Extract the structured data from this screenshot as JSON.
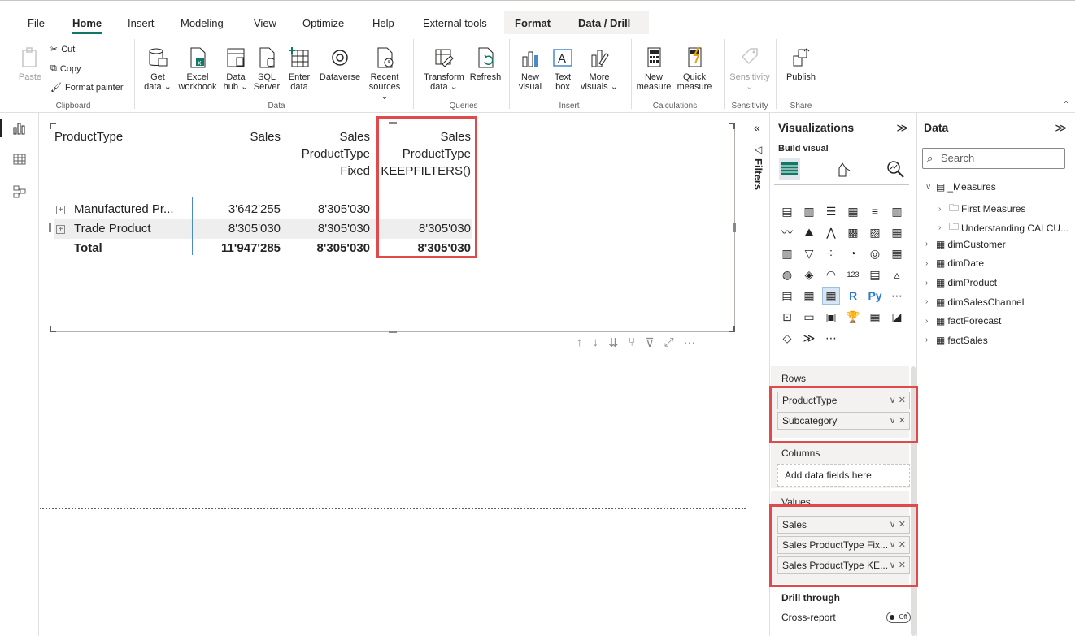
{
  "menu": {
    "tabs": [
      "File",
      "Home",
      "Insert",
      "Modeling",
      "View",
      "Optimize",
      "Help",
      "External tools"
    ],
    "active": "Home",
    "context_tabs": [
      "Format",
      "Data / Drill"
    ]
  },
  "ribbon": {
    "clipboard": {
      "paste": "Paste",
      "cut": "Cut",
      "copy": "Copy",
      "format_painter": "Format painter",
      "label": "Clipboard"
    },
    "data": {
      "get_data": [
        "Get",
        "data ⌄"
      ],
      "excel": [
        "Excel",
        "workbook"
      ],
      "data_hub": [
        "Data",
        "hub ⌄"
      ],
      "sql": [
        "SQL",
        "Server"
      ],
      "enter_data": [
        "Enter",
        "data"
      ],
      "dataverse": [
        "Dataverse",
        ""
      ],
      "recent": [
        "Recent",
        "sources ⌄"
      ],
      "label": "Data"
    },
    "queries": {
      "transform": [
        "Transform",
        "data ⌄"
      ],
      "refresh": [
        "Refresh",
        ""
      ],
      "label": "Queries"
    },
    "insert": {
      "new_visual": [
        "New",
        "visual"
      ],
      "text_box": [
        "Text",
        "box"
      ],
      "more_visuals": [
        "More",
        "visuals ⌄"
      ],
      "label": "Insert"
    },
    "calculations": {
      "new_measure": [
        "New",
        "measure"
      ],
      "quick_measure": [
        "Quick",
        "measure"
      ],
      "label": "Calculations"
    },
    "sensitivity": {
      "button": "Sensitivity",
      "caret": "⌄",
      "label": "Sensitivity"
    },
    "share": {
      "publish": "Publish",
      "label": "Share"
    }
  },
  "matrix": {
    "headers": {
      "row_header": "ProductType",
      "col1": [
        "Sales"
      ],
      "col2": [
        "Sales",
        "ProductType",
        "Fixed"
      ],
      "col3": [
        "Sales",
        "ProductType",
        "KEEPFILTERS()"
      ]
    },
    "rows": [
      {
        "label": "Manufactured Pr...",
        "sales": "3'642'255",
        "fixed": "8'305'030",
        "keep": ""
      },
      {
        "label": "Trade Product",
        "sales": "8'305'030",
        "fixed": "8'305'030",
        "keep": "8'305'030"
      }
    ],
    "total": {
      "label": "Total",
      "sales": "11'947'285",
      "fixed": "8'305'030",
      "keep": "8'305'030"
    },
    "expand_glyph": "+"
  },
  "visual_toolbar": [
    "↑",
    "↓",
    "⇊",
    "⑂",
    "⊽",
    "⤢",
    "⋯"
  ],
  "filters": {
    "label": "Filters",
    "collapse": "«",
    "funnel": "◁"
  },
  "visualizations": {
    "title": "Visualizations",
    "collapse": "≫",
    "build": "Build visual",
    "rows_label": "Rows",
    "rows": [
      "ProductType",
      "Subcategory"
    ],
    "columns_label": "Columns",
    "columns_placeholder": "Add data fields here",
    "values_label": "Values",
    "values": [
      "Sales",
      "Sales ProductType Fix...",
      "Sales ProductType KE..."
    ],
    "drill_label": "Drill through",
    "cross_report": "Cross-report",
    "toggle": "Off",
    "field_actions": "∨ ✕",
    "types": [
      "▤",
      "▥",
      "☰",
      "▦",
      "≡",
      "▥",
      "〰",
      "⛰",
      "⋀",
      "▩",
      "▨",
      "▦",
      "▥",
      "▽",
      "⁘",
      "◔",
      "◎",
      "▦",
      "◍",
      "◈",
      "◠",
      "123",
      "▤",
      "▵",
      "▤",
      "▦",
      "▦",
      "R",
      "Py",
      "⋯",
      "⊡",
      "▭",
      "▣",
      "🏆",
      "▦",
      "◪",
      "◇",
      "≫",
      "⋯"
    ]
  },
  "data_pane": {
    "title": "Data",
    "collapse": "≫",
    "search_placeholder": "Search",
    "items": [
      {
        "label": "_Measures",
        "expanded": true,
        "icon": "measures-folder-icon",
        "indent": 0
      },
      {
        "label": "First Measures",
        "expanded": false,
        "icon": "folder-icon",
        "indent": 1
      },
      {
        "label": "Understanding CALCU...",
        "expanded": false,
        "icon": "folder-icon",
        "indent": 1
      },
      {
        "label": "dimCustomer",
        "expanded": false,
        "icon": "table-icon",
        "indent": 0
      },
      {
        "label": "dimDate",
        "expanded": false,
        "icon": "table-icon",
        "indent": 0
      },
      {
        "label": "dimProduct",
        "expanded": false,
        "icon": "table-check-icon",
        "indent": 0
      },
      {
        "label": "dimSalesChannel",
        "expanded": false,
        "icon": "table-icon",
        "indent": 0
      },
      {
        "label": "factForecast",
        "expanded": false,
        "icon": "table-icon",
        "indent": 0
      },
      {
        "label": "factSales",
        "expanded": false,
        "icon": "table-icon",
        "indent": 0
      }
    ]
  },
  "colors": {
    "accent": "#117865",
    "highlight": "#e04a4a",
    "selection_line": "#4a8ac6",
    "check": "#117865"
  }
}
